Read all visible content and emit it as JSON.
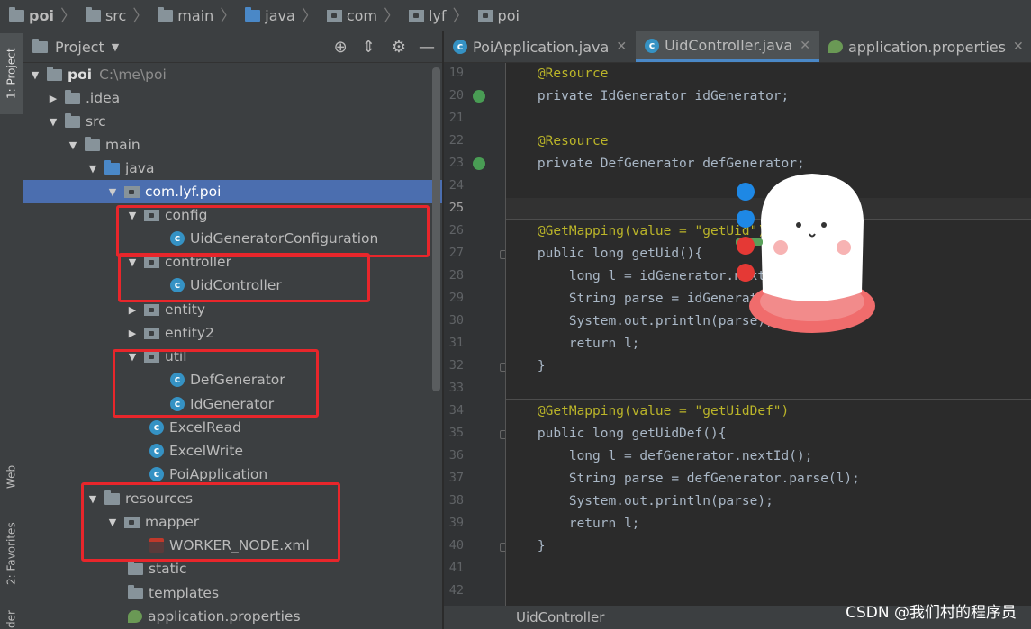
{
  "breadcrumb": [
    "poi",
    "src",
    "main",
    "java",
    "com",
    "lyf",
    "poi"
  ],
  "sidebar_tabs": {
    "project": "1: Project",
    "web": "Web",
    "favorites": "2: Favorites",
    "structure": "der"
  },
  "project_panel": {
    "title": "Project",
    "tree": [
      {
        "label": "poi",
        "extra": "C:\\me\\poi"
      },
      {
        "label": ".idea"
      },
      {
        "label": "src"
      },
      {
        "label": "main"
      },
      {
        "label": "java"
      },
      {
        "label": "com.lyf.poi"
      },
      {
        "label": "config"
      },
      {
        "label": "UidGeneratorConfiguration"
      },
      {
        "label": "controller"
      },
      {
        "label": "UidController"
      },
      {
        "label": "entity"
      },
      {
        "label": "entity2"
      },
      {
        "label": "util"
      },
      {
        "label": "DefGenerator"
      },
      {
        "label": "IdGenerator"
      },
      {
        "label": "ExcelRead"
      },
      {
        "label": "ExcelWrite"
      },
      {
        "label": "PoiApplication"
      },
      {
        "label": "resources"
      },
      {
        "label": "mapper"
      },
      {
        "label": "WORKER_NODE.xml"
      },
      {
        "label": "static"
      },
      {
        "label": "templates"
      },
      {
        "label": "application.properties"
      }
    ]
  },
  "editor_tabs": [
    {
      "label": "PoiApplication.java"
    },
    {
      "label": "UidController.java"
    },
    {
      "label": "application.properties"
    }
  ],
  "code": {
    "line_numbers": [
      "19",
      "20",
      "21",
      "22",
      "23",
      "24",
      "25",
      "26",
      "27",
      "28",
      "29",
      "30",
      "31",
      "32",
      "33",
      "34",
      "35",
      "36",
      "37",
      "38",
      "39",
      "40",
      "41",
      "42"
    ],
    "lines": [
      "    @Resource",
      "    private IdGenerator idGenerator;",
      "",
      "    @Resource",
      "    private DefGenerator defGenerator;",
      "",
      "",
      "    @GetMapping(value = \"getUid\")",
      "    public long getUid(){",
      "        long l = idGenerator.nextId();",
      "        String parse = idGenerator.parse(l);",
      "        System.out.println(parse);",
      "        return l;",
      "    }",
      "",
      "    @GetMapping(value = \"getUidDef\")",
      "    public long getUidDef(){",
      "        long l = defGenerator.nextId();",
      "        String parse = defGenerator.parse(l);",
      "        System.out.println(parse);",
      "        return l;",
      "    }",
      "",
      ""
    ]
  },
  "status_bar": {
    "breadcrumb": "UidController"
  },
  "watermark": "CSDN @我们村的程序员",
  "colors": {
    "highlight_box": "#e8262b",
    "selection": "#4b6eaf",
    "accent": "#4a88c7"
  }
}
